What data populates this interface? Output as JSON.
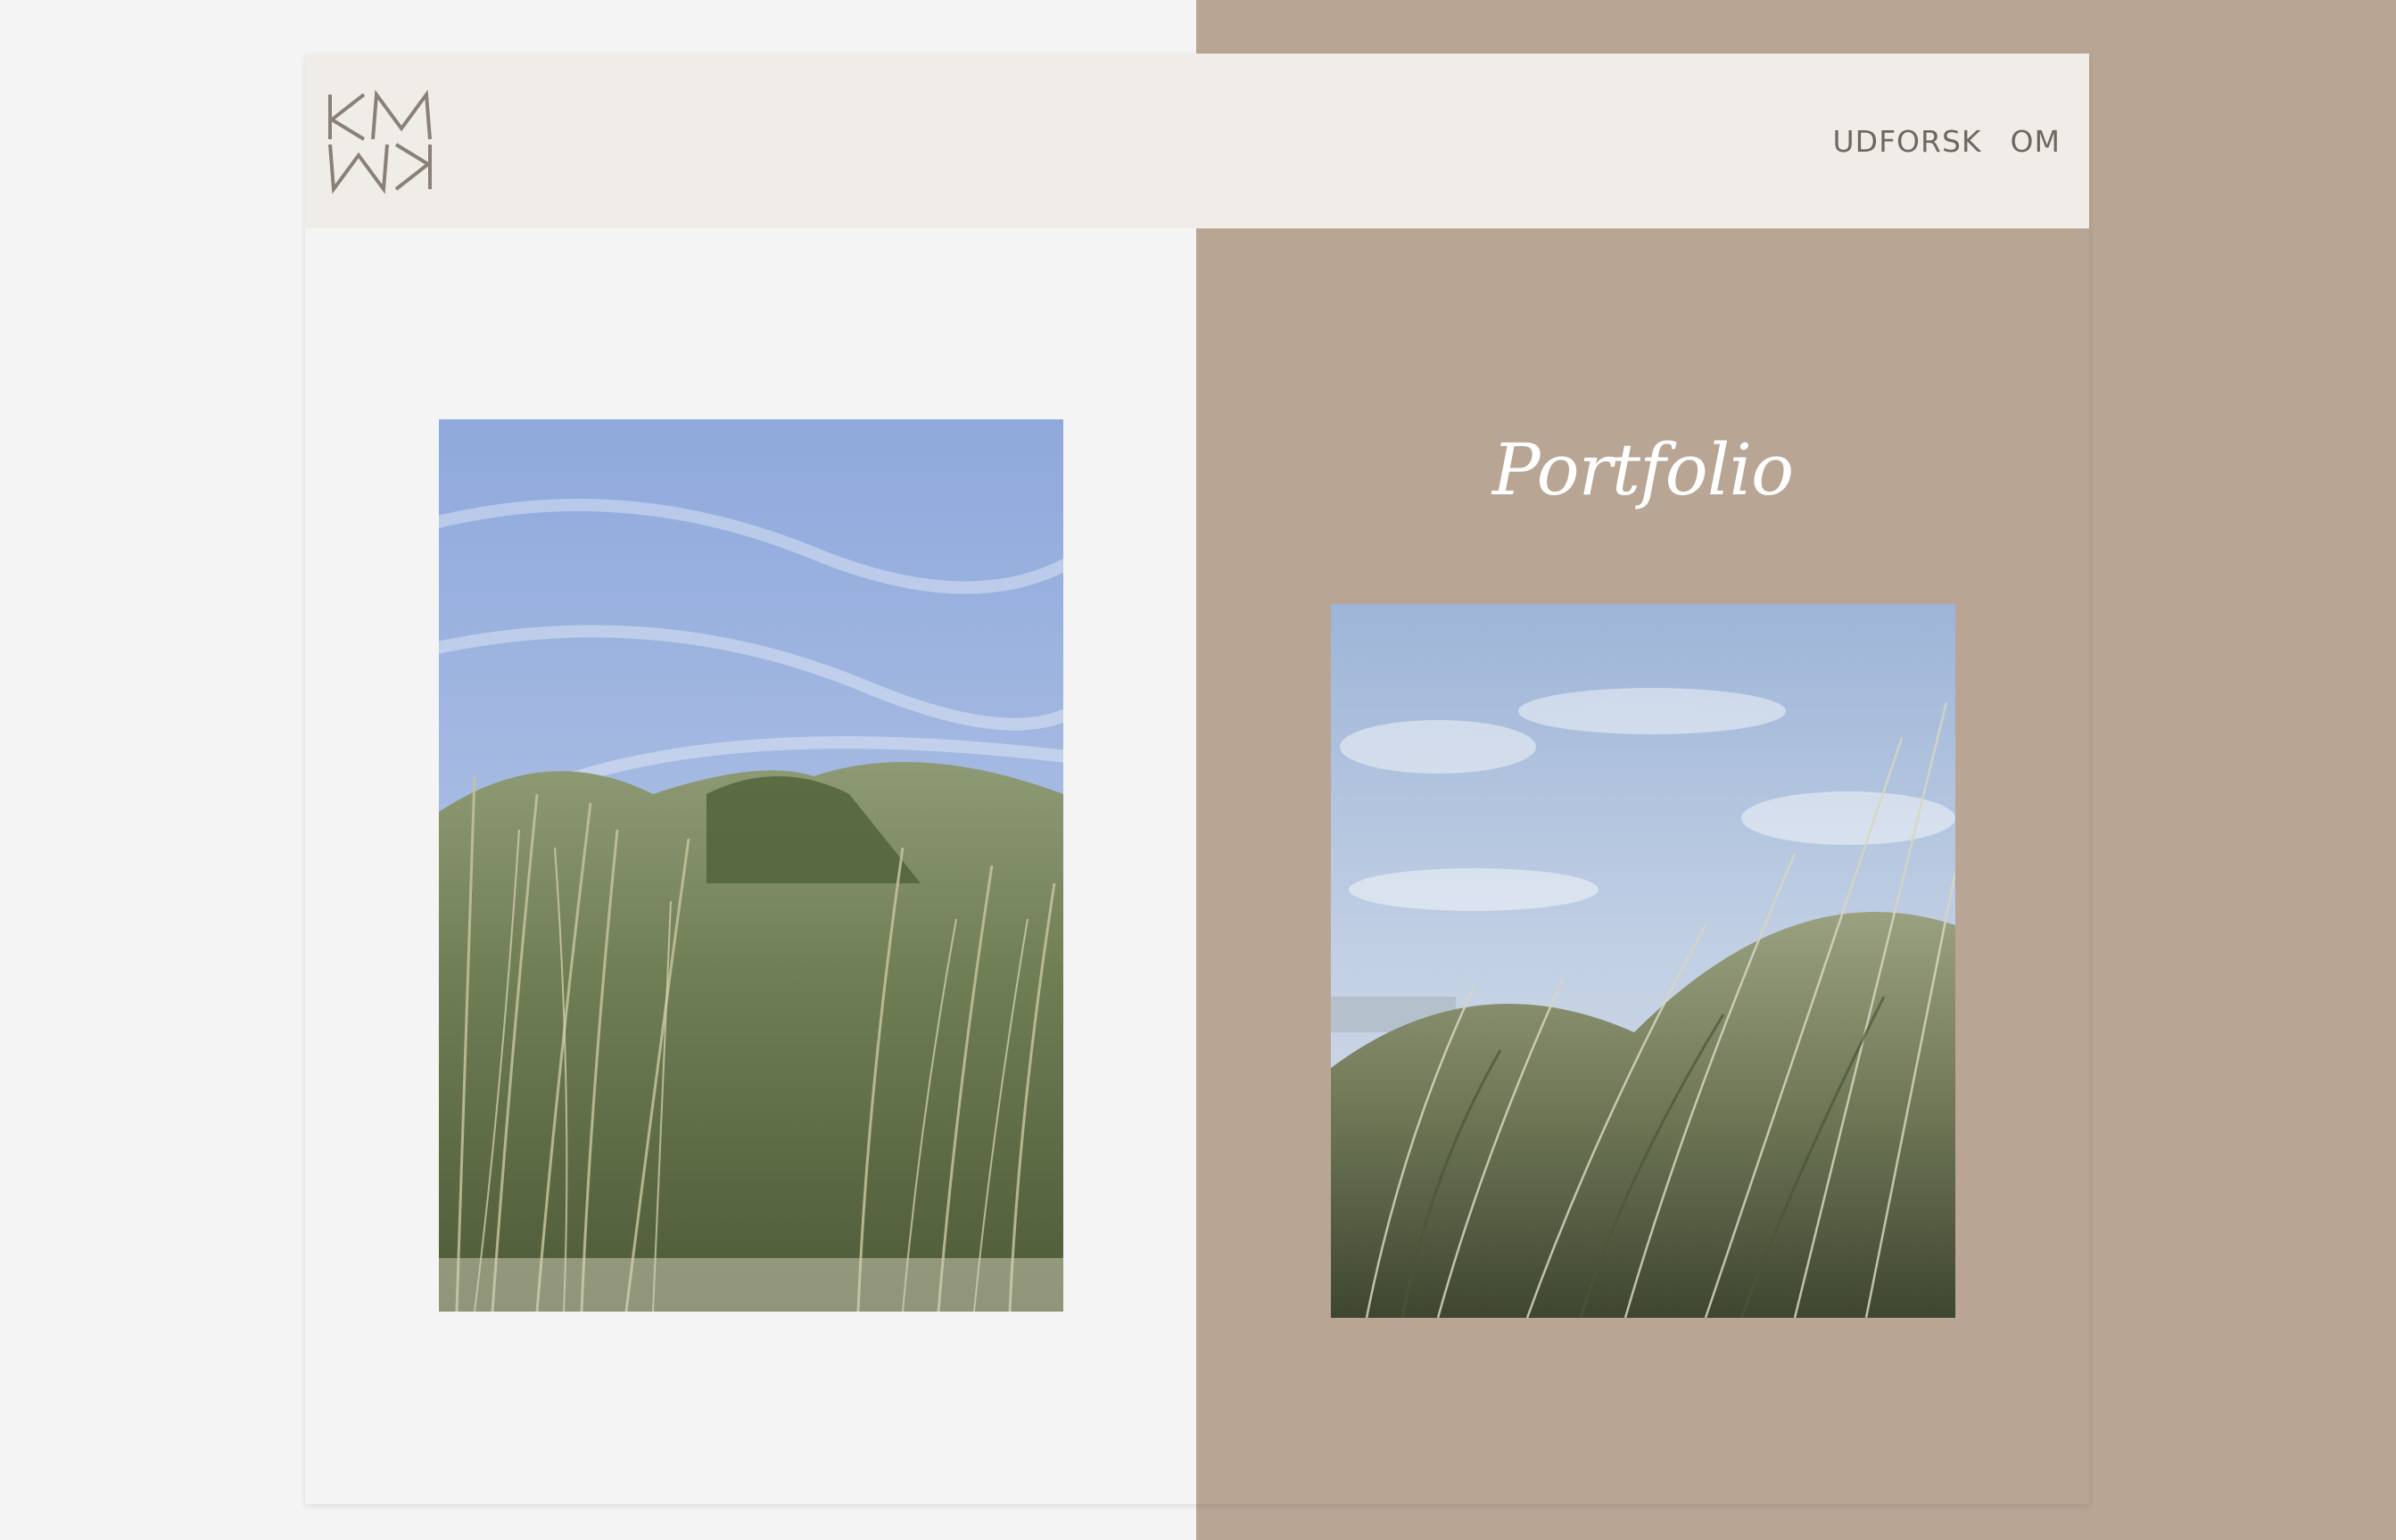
{
  "brand": {
    "logo_text_top": "KM",
    "logo_text_bottom": "KM",
    "logo_icon": "km-monogram-logo"
  },
  "nav": {
    "items": [
      {
        "label": "UDFORSK"
      },
      {
        "label": "OM"
      }
    ]
  },
  "hero": {
    "title": "Portfolio"
  },
  "images": {
    "left": {
      "subject": "dune-grass-photo"
    },
    "right": {
      "subject": "beach-grass-photo"
    }
  },
  "colors": {
    "left_panel": "#f4f4f4",
    "right_panel": "#b8a594",
    "header": "#f0ede9",
    "nav_text": "#6e6862",
    "title_text": "#ffffff"
  }
}
